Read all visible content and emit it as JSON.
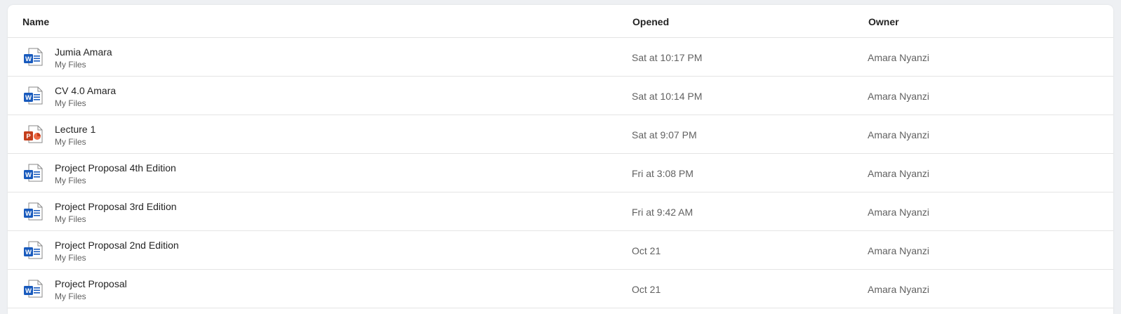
{
  "header": {
    "name_label": "Name",
    "opened_label": "Opened",
    "owner_label": "Owner"
  },
  "colors": {
    "word": "#185abd",
    "powerpoint": "#c43e1c",
    "text_primary": "#242424",
    "text_secondary": "#616161"
  },
  "files": [
    {
      "icon": "word-file-icon",
      "app_letter": "W",
      "title": "Jumia Amara",
      "location": "My Files",
      "opened": "Sat at 10:17 PM",
      "owner": "Amara Nyanzi"
    },
    {
      "icon": "word-file-icon",
      "app_letter": "W",
      "title": "CV 4.0 Amara",
      "location": "My Files",
      "opened": "Sat at 10:14 PM",
      "owner": "Amara Nyanzi"
    },
    {
      "icon": "powerpoint-file-icon",
      "app_letter": "P",
      "title": "Lecture 1",
      "location": "My Files",
      "opened": "Sat at 9:07 PM",
      "owner": "Amara Nyanzi"
    },
    {
      "icon": "word-file-icon",
      "app_letter": "W",
      "title": "Project Proposal 4th Edition",
      "location": "My Files",
      "opened": "Fri at 3:08 PM",
      "owner": "Amara Nyanzi"
    },
    {
      "icon": "word-file-icon",
      "app_letter": "W",
      "title": "Project Proposal 3rd Edition",
      "location": "My Files",
      "opened": "Fri at 9:42 AM",
      "owner": "Amara Nyanzi"
    },
    {
      "icon": "word-file-icon",
      "app_letter": "W",
      "title": "Project Proposal 2nd Edition",
      "location": "My Files",
      "opened": "Oct 21",
      "owner": "Amara Nyanzi"
    },
    {
      "icon": "word-file-icon",
      "app_letter": "W",
      "title": "Project Proposal",
      "location": "My Files",
      "opened": "Oct 21",
      "owner": "Amara Nyanzi"
    }
  ]
}
